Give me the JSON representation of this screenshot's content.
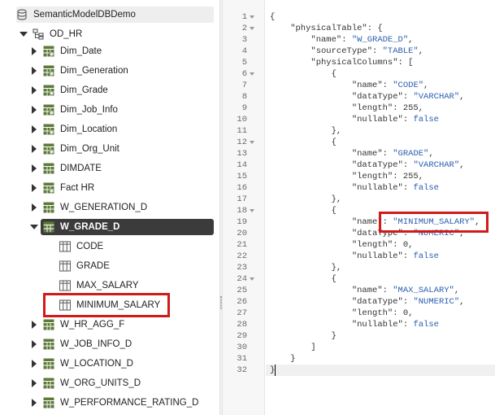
{
  "tree": {
    "root": {
      "label": "SemanticModelDBDemo",
      "icon": "database-icon"
    },
    "schema": {
      "label": "OD_HR",
      "icon": "schema-icon"
    },
    "tables": [
      {
        "label": "Dim_Date",
        "icon": "dimension-table-icon"
      },
      {
        "label": "Dim_Generation",
        "icon": "dimension-table-icon"
      },
      {
        "label": "Dim_Grade",
        "icon": "dimension-table-icon"
      },
      {
        "label": "Dim_Job_Info",
        "icon": "dimension-table-icon"
      },
      {
        "label": "Dim_Location",
        "icon": "dimension-table-icon"
      },
      {
        "label": "Dim_Org_Unit",
        "icon": "dimension-table-icon"
      },
      {
        "label": "DIMDATE",
        "icon": "table-icon"
      },
      {
        "label": "Fact HR",
        "icon": "dimension-table-icon"
      },
      {
        "label": "W_GENERATION_D",
        "icon": "table-icon"
      },
      {
        "label": "W_GRADE_D",
        "icon": "table-icon",
        "expanded": true,
        "selected": true
      },
      {
        "label": "W_HR_AGG_F",
        "icon": "table-icon"
      },
      {
        "label": "W_JOB_INFO_D",
        "icon": "table-icon"
      },
      {
        "label": "W_LOCATION_D",
        "icon": "table-icon"
      },
      {
        "label": "W_ORG_UNITS_D",
        "icon": "table-icon"
      },
      {
        "label": "W_PERFORMANCE_RATING_D",
        "icon": "table-icon"
      }
    ],
    "columns": [
      {
        "label": "CODE",
        "icon": "column-icon"
      },
      {
        "label": "GRADE",
        "icon": "column-icon"
      },
      {
        "label": "MAX_SALARY",
        "icon": "column-icon"
      },
      {
        "label": "MINIMUM_SALARY",
        "icon": "column-icon",
        "highlighted": true
      }
    ]
  },
  "editor": {
    "line_numbers": [
      "1",
      "2",
      "3",
      "4",
      "5",
      "6",
      "7",
      "8",
      "9",
      "10",
      "11",
      "12",
      "13",
      "14",
      "15",
      "16",
      "17",
      "18",
      "19",
      "20",
      "21",
      "22",
      "23",
      "24",
      "25",
      "26",
      "27",
      "28",
      "29",
      "30",
      "31",
      "32"
    ],
    "fold_lines": [
      1,
      2,
      6,
      12,
      18,
      24
    ],
    "lines": [
      [
        [
          "p",
          "{"
        ]
      ],
      [
        [
          "p",
          "    \"physicalTable\": {"
        ]
      ],
      [
        [
          "p",
          "        \"name\": "
        ],
        [
          "s",
          "\"W_GRADE_D\""
        ],
        [
          "p",
          ","
        ]
      ],
      [
        [
          "p",
          "        \"sourceType\": "
        ],
        [
          "s",
          "\"TABLE\""
        ],
        [
          "p",
          ","
        ]
      ],
      [
        [
          "p",
          "        \"physicalColumns\": ["
        ]
      ],
      [
        [
          "p",
          "            {"
        ]
      ],
      [
        [
          "p",
          "                \"name\": "
        ],
        [
          "s",
          "\"CODE\""
        ],
        [
          "p",
          ","
        ]
      ],
      [
        [
          "p",
          "                \"dataType\": "
        ],
        [
          "s",
          "\"VARCHAR\""
        ],
        [
          "p",
          ","
        ]
      ],
      [
        [
          "p",
          "                \"length\": 255,"
        ]
      ],
      [
        [
          "p",
          "                \"nullable\": "
        ],
        [
          "k",
          "false"
        ]
      ],
      [
        [
          "p",
          "            },"
        ]
      ],
      [
        [
          "p",
          "            {"
        ]
      ],
      [
        [
          "p",
          "                \"name\": "
        ],
        [
          "s",
          "\"GRADE\""
        ],
        [
          "p",
          ","
        ]
      ],
      [
        [
          "p",
          "                \"dataType\": "
        ],
        [
          "s",
          "\"VARCHAR\""
        ],
        [
          "p",
          ","
        ]
      ],
      [
        [
          "p",
          "                \"length\": 255,"
        ]
      ],
      [
        [
          "p",
          "                \"nullable\": "
        ],
        [
          "k",
          "false"
        ]
      ],
      [
        [
          "p",
          "            },"
        ]
      ],
      [
        [
          "p",
          "            {"
        ]
      ],
      [
        [
          "p",
          "                \"name\": "
        ],
        [
          "s",
          "\"MINIMUM_SALARY\""
        ],
        [
          "p",
          ","
        ]
      ],
      [
        [
          "p",
          "                \"dataType\": "
        ],
        [
          "s",
          "\"NUMERIC\""
        ],
        [
          "p",
          ","
        ]
      ],
      [
        [
          "p",
          "                \"length\": 0,"
        ]
      ],
      [
        [
          "p",
          "                \"nullable\": "
        ],
        [
          "k",
          "false"
        ]
      ],
      [
        [
          "p",
          "            },"
        ]
      ],
      [
        [
          "p",
          "            {"
        ]
      ],
      [
        [
          "p",
          "                \"name\": "
        ],
        [
          "s",
          "\"MAX_SALARY\""
        ],
        [
          "p",
          ","
        ]
      ],
      [
        [
          "p",
          "                \"dataType\": "
        ],
        [
          "s",
          "\"NUMERIC\""
        ],
        [
          "p",
          ","
        ]
      ],
      [
        [
          "p",
          "                \"length\": 0,"
        ]
      ],
      [
        [
          "p",
          "                \"nullable\": "
        ],
        [
          "k",
          "false"
        ]
      ],
      [
        [
          "p",
          "            }"
        ]
      ],
      [
        [
          "p",
          "        ]"
        ]
      ],
      [
        [
          "p",
          "    }"
        ]
      ],
      [
        [
          "p",
          "}"
        ]
      ]
    ]
  },
  "colors": {
    "highlight_border": "#d11a1a",
    "selected_row": "#3b3b3b",
    "json_string": "#2a5db0"
  }
}
